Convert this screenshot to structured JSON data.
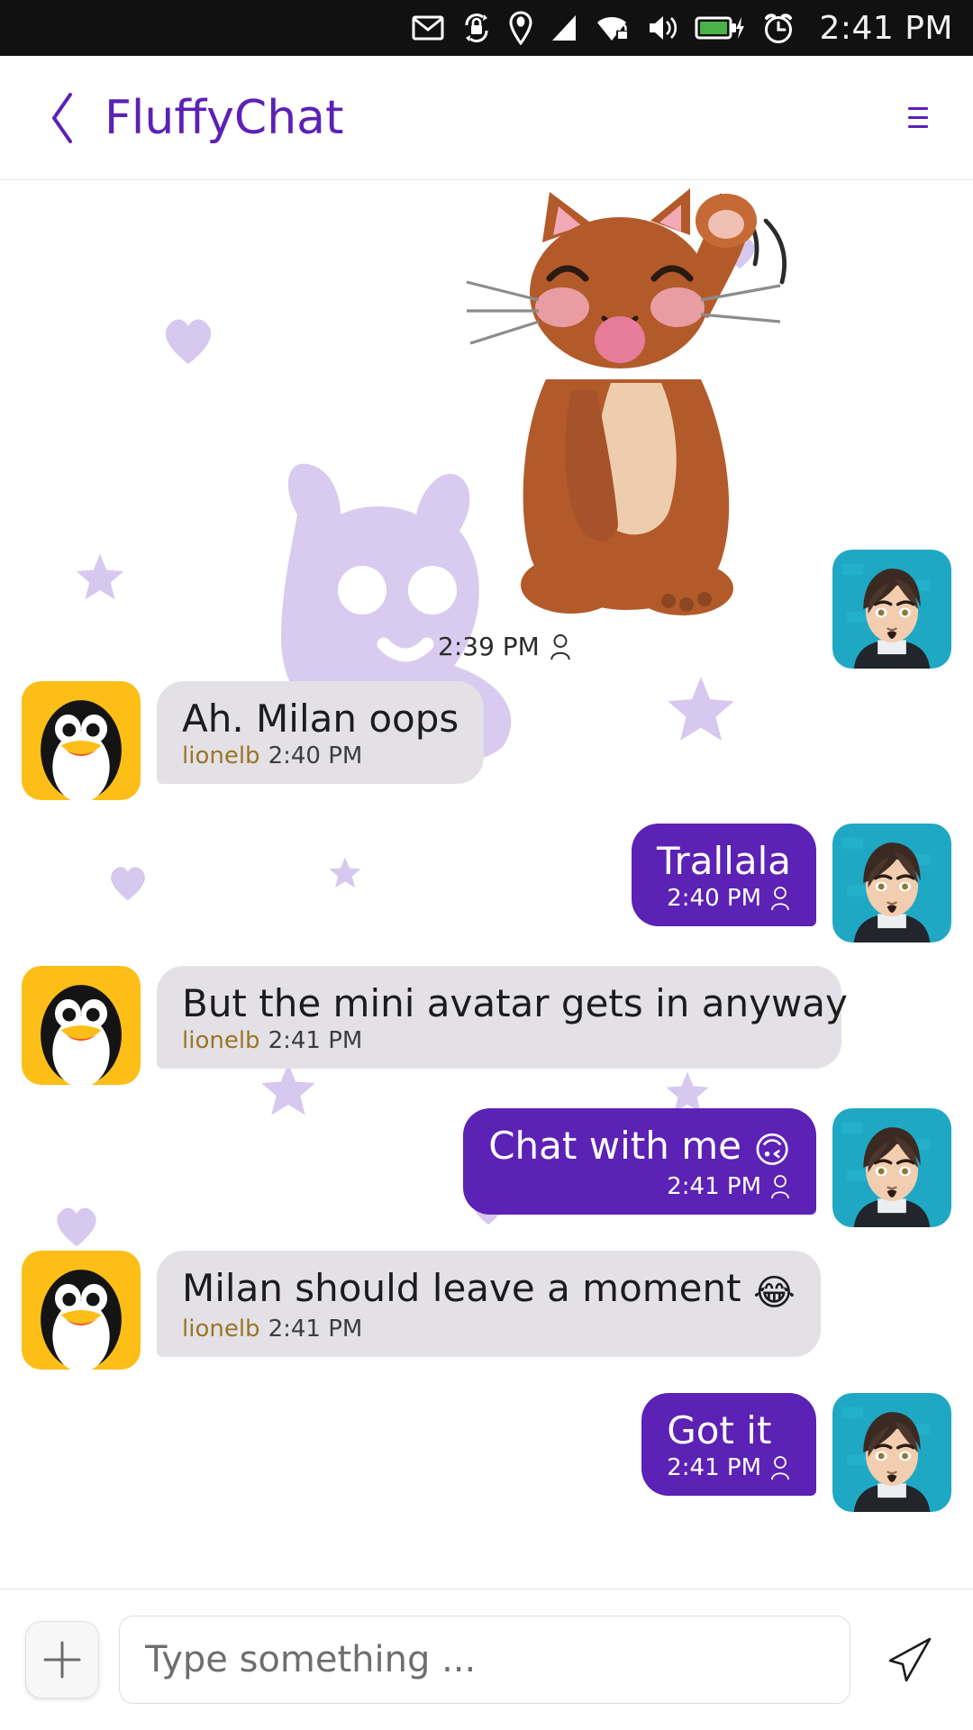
{
  "statusbar": {
    "time": "2:41 PM",
    "icons": [
      "mail-icon",
      "sync-lock-icon",
      "location-pin-icon",
      "cell-signal-icon",
      "wifi-locked-icon",
      "volume-icon",
      "battery-charging-icon",
      "alarm-clock-icon"
    ]
  },
  "appbar": {
    "title": "FluffyChat",
    "back_label": "‹",
    "menu_label": "menu"
  },
  "colors": {
    "accent": "#5c21b5",
    "incoming_bubble": "#e3e1e6",
    "outgoing_bubble": "#5c21b5",
    "sender_name": "#9a7526",
    "decoration": "#d6c8ee",
    "status_bar": "#111111",
    "battery_green": "#49b349"
  },
  "messages": [
    {
      "type": "sticker",
      "side": "right",
      "alt": "waving-cat-sticker",
      "time": "2:39 PM",
      "status_icon": "person-icon",
      "avatar": "anime-man-avatar"
    },
    {
      "type": "text",
      "side": "left",
      "text": "Ah. Milan oops",
      "sender": "lionelb",
      "time": "2:40 PM",
      "avatar": "tux-penguin-avatar"
    },
    {
      "type": "text",
      "side": "right",
      "text": "Trallala",
      "time": "2:40 PM",
      "status_icon": "person-icon",
      "avatar": "anime-man-avatar"
    },
    {
      "type": "text",
      "side": "left",
      "text": "But the mini avatar gets in anyway",
      "sender": "lionelb",
      "time": "2:41 PM",
      "avatar": "tux-penguin-avatar"
    },
    {
      "type": "text",
      "side": "right",
      "text": "Chat with me ",
      "emoji": "🙃",
      "time": "2:41 PM",
      "status_icon": "person-icon",
      "avatar": "anime-man-avatar"
    },
    {
      "type": "text",
      "side": "left",
      "text": "Milan should leave a moment ",
      "emoji": "😂",
      "sender": "lionelb",
      "time": "2:41 PM",
      "avatar": "tux-penguin-avatar"
    },
    {
      "type": "text",
      "side": "right",
      "text": "Got it",
      "time": "2:41 PM",
      "status_icon": "person-icon",
      "avatar": "anime-man-avatar"
    }
  ],
  "composer": {
    "add_label": "+",
    "placeholder": "Type something ...",
    "value": "",
    "send_label": "send"
  }
}
